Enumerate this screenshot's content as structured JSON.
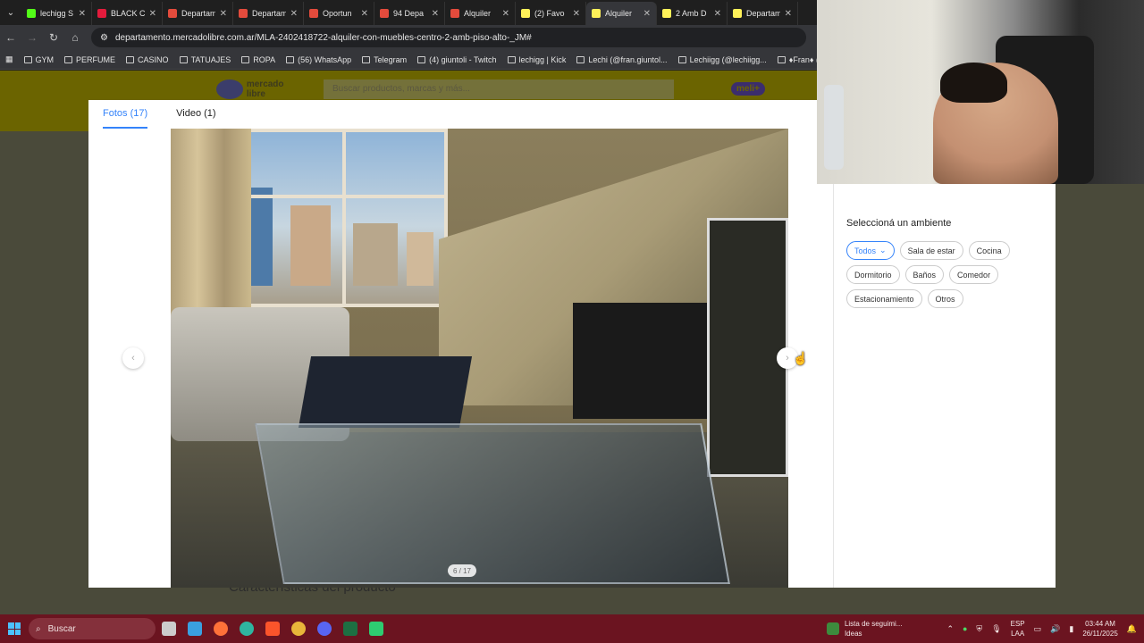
{
  "browser": {
    "tabs": [
      {
        "label": "lechigg S",
        "color": "#53fc18"
      },
      {
        "label": "BLACK C",
        "color": "#e31b3c"
      },
      {
        "label": "Departam",
        "color": "#e34b3c"
      },
      {
        "label": "Departam",
        "color": "#e34b3c"
      },
      {
        "label": "Oportun",
        "color": "#e34b3c"
      },
      {
        "label": "94 Depa",
        "color": "#e34b3c"
      },
      {
        "label": "Alquiler",
        "color": "#e34b3c"
      },
      {
        "label": "(2) Favo",
        "color": "#fff159"
      },
      {
        "label": "Alquiler",
        "color": "#fff159",
        "active": true
      },
      {
        "label": "2 Amb D",
        "color": "#fff159"
      },
      {
        "label": "Departam",
        "color": "#fff159"
      }
    ],
    "url": "departamento.mercadolibre.com.ar/MLA-2402418722-alquiler-con-muebles-centro-2-amb-piso-alto-_JM#",
    "bookmarks": [
      "GYM",
      "PERFUME",
      "CASINO",
      "TATUAJES",
      "ROPA",
      "(56) WhatsApp",
      "Telegram",
      "(4) giuntoli - Twitch",
      "lechigg | Kick",
      "Lechi (@fran.giuntol...",
      "Lechiigg (@lechiigg...",
      "♦Fran♦ (@frangiunt..."
    ]
  },
  "site": {
    "logo_text": "mercado libre",
    "search_placeholder": "Buscar productos, marcas y más...",
    "meli_label": "meli+",
    "bottom_heading": "Características del producto"
  },
  "gallery": {
    "tabs": [
      "Fotos (17)",
      "Video (1)"
    ],
    "counter": "6 / 17",
    "side_title": "Seleccioná un ambiente",
    "chips": [
      "Todos",
      "Sala de estar",
      "Cocina",
      "Dormitorio",
      "Baños",
      "Comedor",
      "Estacionamiento",
      "Otros"
    ],
    "active_chip": "Todos",
    "accent": "#3483fa"
  },
  "taskbar": {
    "search_label": "Buscar",
    "widget_title": "Lista de seguimi...",
    "widget_sub": "Ideas",
    "lang_top": "ESP",
    "lang_bottom": "LAA",
    "time": "03:44 AM",
    "date": "26/11/2025"
  }
}
